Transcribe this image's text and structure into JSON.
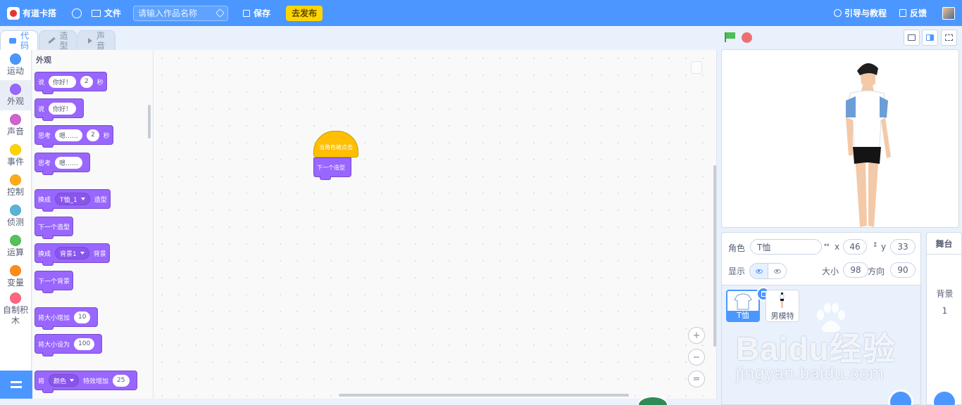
{
  "app": {
    "logo_text": "有道卡搭",
    "file_menu": "文件",
    "title_placeholder": "请输入作品名称",
    "save_label": "保存",
    "publish_label": "去发布",
    "guide_label": "引导与教程",
    "feedback_label": "反馈",
    "accent": "#4c97ff"
  },
  "tabs": [
    {
      "label": "代码",
      "icon": "code-icon",
      "active": true
    },
    {
      "label": "造型",
      "icon": "brush-icon",
      "active": false
    },
    {
      "label": "声音",
      "icon": "speaker-icon",
      "active": false
    }
  ],
  "categories": [
    {
      "label": "运动",
      "color": "#4c97ff"
    },
    {
      "label": "外观",
      "color": "#9966ff"
    },
    {
      "label": "声音",
      "color": "#cf63cf"
    },
    {
      "label": "事件",
      "color": "#ffd500"
    },
    {
      "label": "控制",
      "color": "#ffab19"
    },
    {
      "label": "侦测",
      "color": "#5cb1d6"
    },
    {
      "label": "运算",
      "color": "#59c059"
    },
    {
      "label": "变量",
      "color": "#ff8c1a"
    },
    {
      "label": "自制积木",
      "color": "#ff6680"
    }
  ],
  "palette": {
    "section_title": "外观",
    "blocks": {
      "say_secs": {
        "t1": "说",
        "v1": "你好！",
        "v2": "2",
        "t2": "秒"
      },
      "say": {
        "t1": "说",
        "v1": "你好！"
      },
      "think_secs": {
        "t1": "思考",
        "v1": "嗯……",
        "v2": "2",
        "t2": "秒"
      },
      "think": {
        "t1": "思考",
        "v1": "嗯……"
      },
      "switch_costume": {
        "t1": "换成",
        "v1": "T恤_1",
        "t2": "造型"
      },
      "next_costume": {
        "t1": "下一个造型"
      },
      "switch_backdrop": {
        "t1": "换成",
        "v1": "背景1",
        "t2": "背景"
      },
      "next_backdrop": {
        "t1": "下一个背景"
      },
      "change_size": {
        "t1": "将大小增加",
        "v1": "10"
      },
      "set_size": {
        "t1": "将大小设为",
        "v1": "100"
      },
      "change_effect": {
        "t1": "将",
        "v1": "颜色",
        "t2": "特效增加",
        "v2": "25"
      }
    }
  },
  "script": {
    "hat_label": "当角色被点击",
    "next_label": "下一个造型"
  },
  "zoom": {
    "in": "+",
    "out": "−",
    "reset": "="
  },
  "sprite_info": {
    "sprite_label": "角色",
    "sprite_name": "T恤",
    "x_label": "x",
    "x_value": "46",
    "y_label": "y",
    "y_value": "33",
    "show_label": "显示",
    "size_label": "大小",
    "size_value": "98",
    "direction_label": "方向",
    "direction_value": "90"
  },
  "sprites": [
    {
      "name": "T恤",
      "selected": true
    },
    {
      "name": "男模特",
      "selected": false
    }
  ],
  "stage_panel": {
    "title": "舞台",
    "backdrop_label": "背景",
    "backdrop_count": "1"
  },
  "watermark": {
    "brand": "Baidu经验",
    "url": "jingyan.baidu.com"
  }
}
